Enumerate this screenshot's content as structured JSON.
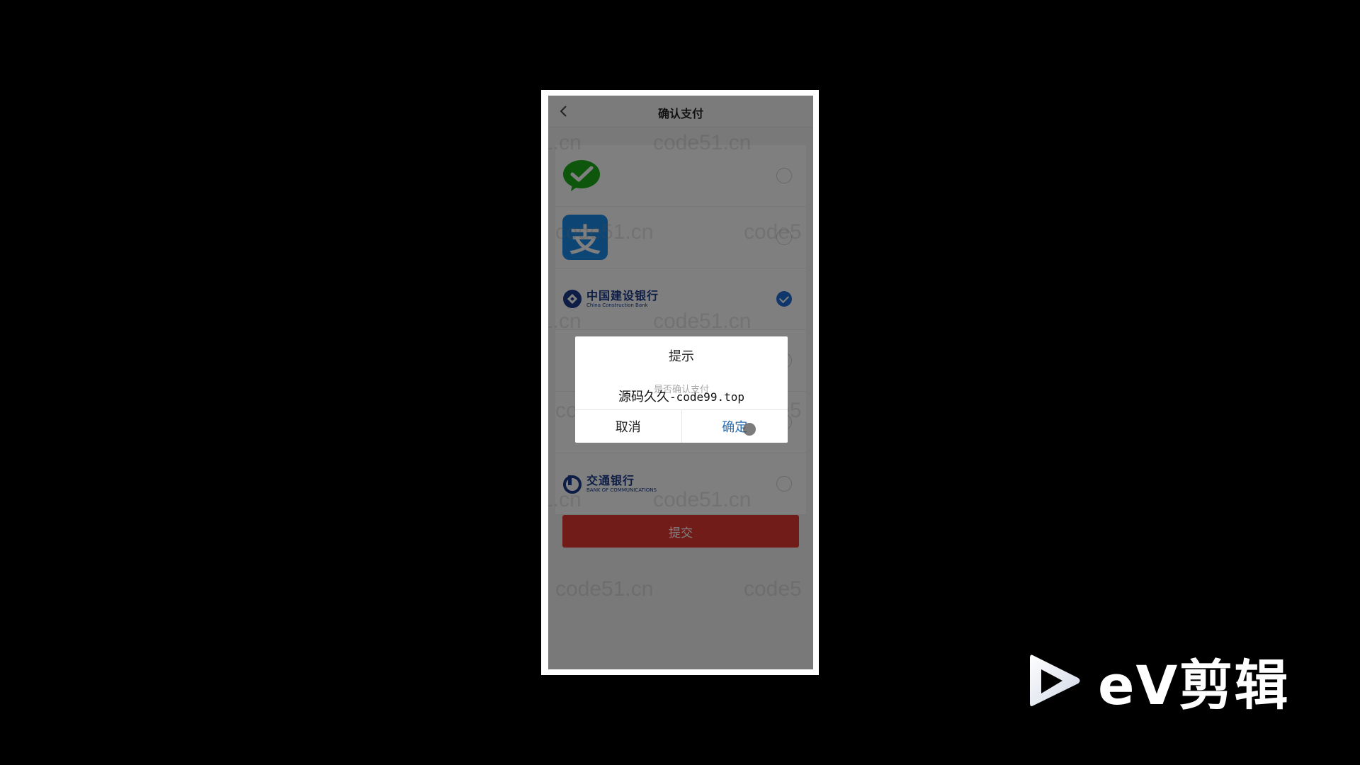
{
  "nav": {
    "title": "确认支付"
  },
  "payment_methods": [
    {
      "name": "wechat",
      "icon": "wechat-pay-icon",
      "selected": false
    },
    {
      "name": "alipay",
      "icon": "alipay-icon",
      "glyph": "支",
      "selected": false
    },
    {
      "name": "ccb",
      "icon": "ccb-logo",
      "cn": "中国建设银行",
      "en": "China Construction Bank",
      "selected": true
    },
    {
      "name": "bocom",
      "icon": "bocom-logo",
      "cn": "交通银行",
      "en": "BANK OF COMMUNICATIONS",
      "selected": false
    }
  ],
  "submit": {
    "label": "提交"
  },
  "dialog": {
    "title": "提示",
    "message": "是否确认支付",
    "overlay_prefix": "源码久久",
    "overlay_suffix": "-code99.top",
    "cancel_label": "取消",
    "confirm_label": "确定"
  },
  "watermark": {
    "text": "code51.cn",
    "partial_left": "1.cn",
    "partial_right": "code5"
  },
  "brand": {
    "logo_text": "eV剪辑"
  },
  "colors": {
    "submit": "#e53935",
    "selected_radio": "#1e6fd9",
    "confirm_text": "#2a6fb0",
    "bank_blue": "#1b3a8a",
    "wechat_green": "#1aad19",
    "alipay_blue": "#1a8be8"
  }
}
